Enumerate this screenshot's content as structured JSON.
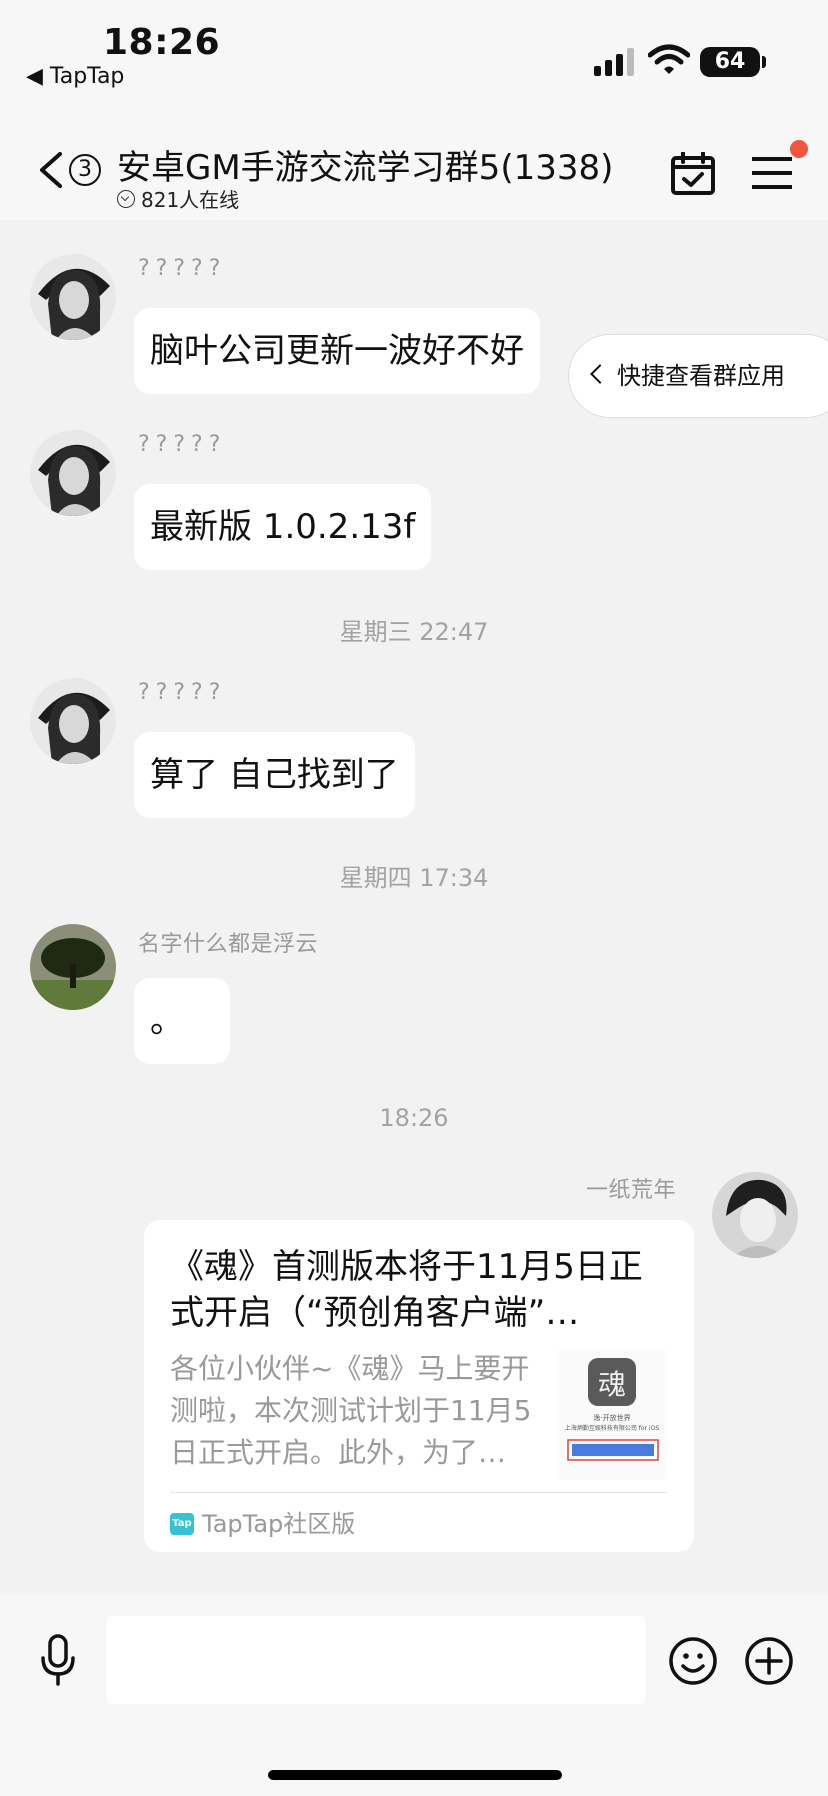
{
  "status": {
    "time": "18:26",
    "back_app": "◀ TapTap",
    "battery": "64"
  },
  "nav": {
    "unread_count": "3",
    "title": "安卓GM手游交流学习群5(1338)",
    "online": "821人在线"
  },
  "quick_app": {
    "label": "快捷查看群应用"
  },
  "messages": [
    {
      "sender": "?????",
      "text": "脑叶公司更新一波好不好"
    },
    {
      "sender": "?????",
      "text": "最新版 1.0.2.13f"
    },
    {
      "timestamp": "星期三 22:47"
    },
    {
      "sender": "?????",
      "text": "算了 自己找到了"
    },
    {
      "timestamp": "星期四 17:34"
    },
    {
      "sender": "名字什么都是浮云",
      "text": "。"
    },
    {
      "timestamp": "18:26"
    },
    {
      "sender": "一纸荒年"
    }
  ],
  "card": {
    "title": "《魂》首测版本将于11月5日正式开启（“预创角客户端”…",
    "desc": "各位小伙伴~《魂》马上要开测啦，本次测试计划于11月5日正式开启。此外，为了…",
    "thumb_caption": "逸·开放世界\n上海炳勤互娱科技有限公司 for iOS",
    "source": "TapTap社区版",
    "logo_text": "Tap"
  },
  "colors": {
    "badge_red": "#f2553e",
    "tap_cyan": "#35c3d4",
    "background": "#f2f2f2"
  }
}
